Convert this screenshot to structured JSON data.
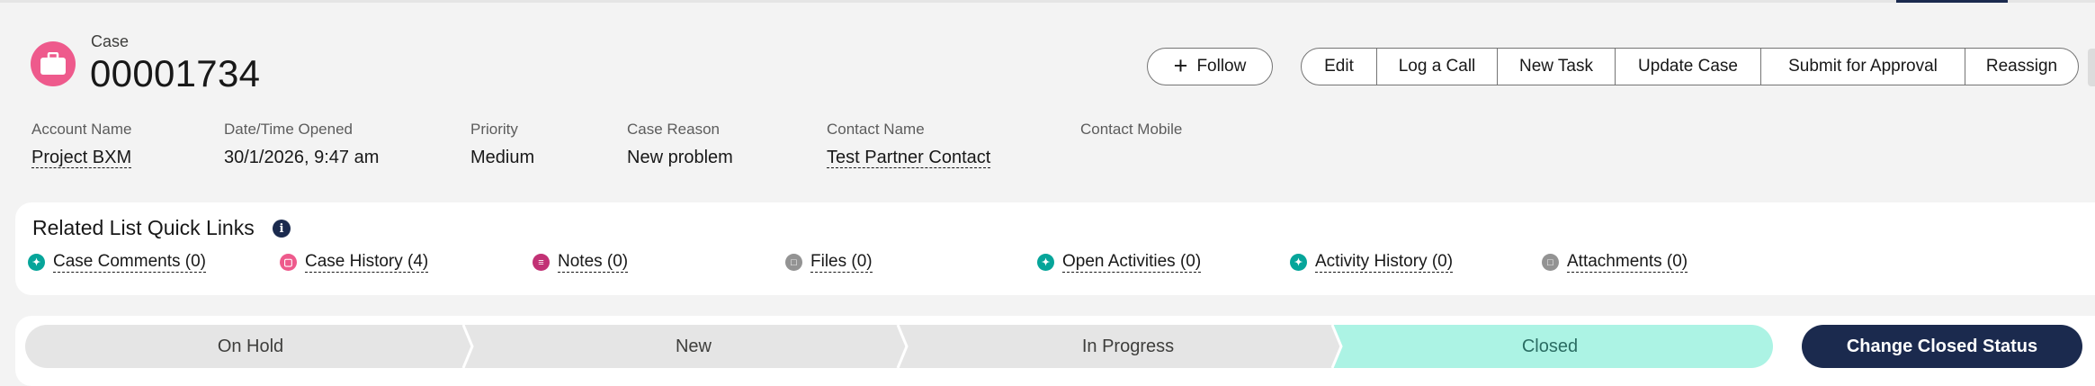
{
  "header": {
    "object_label": "Case",
    "record_number": "00001734"
  },
  "follow_button": {
    "label": "Follow"
  },
  "actions": [
    "Edit",
    "Log a Call",
    "New Task",
    "Update Case",
    "Submit for Approval",
    "Reassign"
  ],
  "fields": [
    {
      "label": "Account Name",
      "value": "Project BXM",
      "link": true
    },
    {
      "label": "Date/Time Opened",
      "value": "30/1/2026, 9:47 am",
      "link": false
    },
    {
      "label": "Priority",
      "value": "Medium",
      "link": false
    },
    {
      "label": "Case Reason",
      "value": "New problem",
      "link": false
    },
    {
      "label": "Contact Name",
      "value": "Test Partner Contact",
      "link": true
    },
    {
      "label": "Contact Mobile",
      "value": "",
      "link": false
    }
  ],
  "quick_links": {
    "title": "Related List Quick Links",
    "items": [
      {
        "label": "Case Comments (0)",
        "icon": "wrench-icon",
        "color": "#06a59a"
      },
      {
        "label": "Case History (4)",
        "icon": "briefcase-icon",
        "color": "#ee5a8c"
      },
      {
        "label": "Notes (0)",
        "icon": "notes-icon",
        "color": "#c23175"
      },
      {
        "label": "Files (0)",
        "icon": "file-icon",
        "color": "#939393"
      },
      {
        "label": "Open Activities (0)",
        "icon": "wrench-icon",
        "color": "#06a59a"
      },
      {
        "label": "Activity History (0)",
        "icon": "wrench-icon",
        "color": "#06a59a"
      },
      {
        "label": "Attachments (0)",
        "icon": "attachment-icon",
        "color": "#939393"
      }
    ]
  },
  "path": {
    "stages": [
      "On Hold",
      "New",
      "In Progress",
      "Closed"
    ],
    "current_stage": "Closed",
    "stage_color": "#e5e5e5",
    "current_color": "#acf3e4",
    "button_label": "Change Closed Status"
  },
  "colors": {
    "brand_dark": "#1b2a4e",
    "case_icon": "#ee5a8c"
  }
}
